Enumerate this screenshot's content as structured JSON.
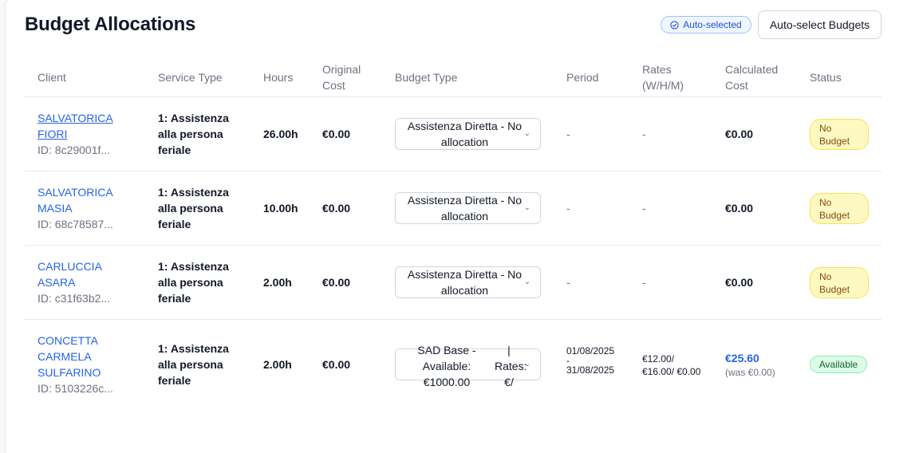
{
  "header": {
    "title": "Budget Allocations",
    "auto_badge": "Auto-selected",
    "auto_button": "Auto-select Budgets"
  },
  "columns": {
    "client": "Client",
    "service_type": "Service Type",
    "hours": "Hours",
    "original_cost_1": "Original",
    "original_cost_2": "Cost",
    "budget_type": "Budget Type",
    "period": "Period",
    "rates_1": "Rates",
    "rates_2": "(W/H/M)",
    "calculated_cost_1": "Calculated",
    "calculated_cost_2": "Cost",
    "status": "Status"
  },
  "rows": [
    {
      "client_line1": "SALVATORICA",
      "client_line2": "FIORI",
      "client_id": "ID: 8c29001f...",
      "service_1": "1: Assistenza",
      "service_2": "alla persona",
      "service_3": "feriale",
      "hours": "26.00h",
      "original_cost": "€0.00",
      "budget_1": "Assistenza Diretta - No",
      "budget_2": "allocation",
      "period": "-",
      "rates": "-",
      "calculated_cost": "€0.00",
      "status_1": "No",
      "status_2": "Budget"
    },
    {
      "client_line1": "SALVATORICA",
      "client_line2": "MASIA",
      "client_id": "ID: 68c78587...",
      "service_1": "1: Assistenza",
      "service_2": "alla persona",
      "service_3": "feriale",
      "hours": "10.00h",
      "original_cost": "€0.00",
      "budget_1": "Assistenza Diretta - No",
      "budget_2": "allocation",
      "period": "-",
      "rates": "-",
      "calculated_cost": "€0.00",
      "status_1": "No",
      "status_2": "Budget"
    },
    {
      "client_line1": "CARLUCCIA",
      "client_line2": "ASARA",
      "client_id": "ID: c31f63b2...",
      "service_1": "1: Assistenza",
      "service_2": "alla persona",
      "service_3": "feriale",
      "hours": "2.00h",
      "original_cost": "€0.00",
      "budget_1": "Assistenza Diretta - No",
      "budget_2": "allocation",
      "period": "-",
      "rates": "-",
      "calculated_cost": "€0.00",
      "status_1": "No",
      "status_2": "Budget"
    },
    {
      "client_line1": "CONCETTA",
      "client_line2": "CARMELA",
      "client_line3": "SULFARINO",
      "client_id": "ID: 5103226c...",
      "service_1": "1: Assistenza",
      "service_2": "alla persona",
      "service_3": "feriale",
      "hours": "2.00h",
      "original_cost": "€0.00",
      "budget_a1": "SAD Base -",
      "budget_a2": "Available:",
      "budget_a3": "€1000.00",
      "budget_b1": "|",
      "budget_b2": "Rates:",
      "budget_b3": "€/",
      "period_1": "01/08/2025",
      "period_2": "-",
      "period_3": "31/08/2025",
      "rates_1": "€12.00/",
      "rates_2": "€16.00/ €0.00",
      "calculated_cost": "€25.60",
      "calculated_was": "(was €0.00)",
      "status": "Available"
    }
  ]
}
